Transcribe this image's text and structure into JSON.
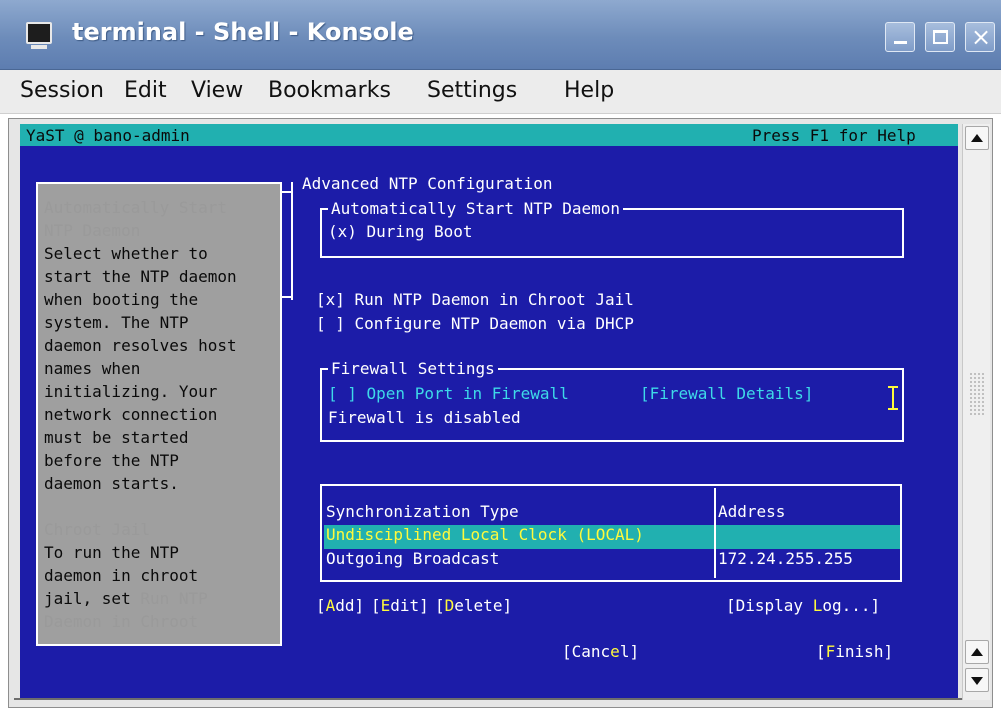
{
  "window": {
    "title": "terminal - Shell - Konsole",
    "close_glyph": "×"
  },
  "menu": [
    "Session",
    "Edit",
    "View",
    "Bookmarks",
    "Settings",
    "Help"
  ],
  "terminal": {
    "header_left": "YaST @ bano-admin",
    "header_right": "Press F1 for Help",
    "dialog_title": "Advanced NTP Configuration",
    "help": {
      "heading1_line1": "Automatically Start",
      "heading1_line2": "NTP Daemon",
      "body1": [
        "Select whether to",
        "start the NTP daemon",
        "when booting the",
        "system. The NTP",
        "daemon resolves host",
        "names when",
        "initializing. Your",
        "network connection",
        "must be started",
        "before the NTP",
        "daemon starts."
      ],
      "heading2": "Chroot Jail",
      "body2": [
        "To run the NTP",
        "daemon in chroot"
      ],
      "body2_line3_prefix": "jail, set ",
      "body2_line3_link": "Run NTP",
      "body2_line4_link": "Daemon in Chroot"
    },
    "autostart": {
      "group_title": "Automatically Start NTP Daemon",
      "option": "(x) During Boot"
    },
    "checkboxes": {
      "chroot": "[x] Run NTP Daemon in Chroot Jail",
      "dhcp": "[ ] Configure NTP Daemon via DHCP"
    },
    "firewall": {
      "group_title": "Firewall Settings",
      "open_port": "[ ] Open Port in Firewall",
      "details_button": "[Firewall Details]",
      "status": "Firewall is disabled"
    },
    "table": {
      "headers": [
        "Synchronization Type",
        "Address"
      ],
      "rows": [
        [
          "Undisciplined Local Clock (LOCAL)",
          ""
        ],
        [
          "Outgoing Broadcast",
          "172.24.255.255"
        ]
      ]
    },
    "actions": {
      "add_b": "[",
      "add_h": "A",
      "add_t": "dd]",
      "edit_b": "[",
      "edit_h": "E",
      "edit_t": "dit]",
      "delete_b": "[",
      "delete_h": "D",
      "delete_t": "elete]",
      "log_b": "[Display ",
      "log_h": "L",
      "log_t": "og...]",
      "cancel_b": "[Canc",
      "cancel_h": "e",
      "cancel_t": "l]",
      "finish_b": "[",
      "finish_h": "F",
      "finish_t": "inish]"
    }
  },
  "colors": {
    "terminal_bg": "#1c1ca8",
    "header_bg": "#21b0b0",
    "help_bg": "#9f9f9f",
    "highlight_text": "#fffa3c"
  }
}
